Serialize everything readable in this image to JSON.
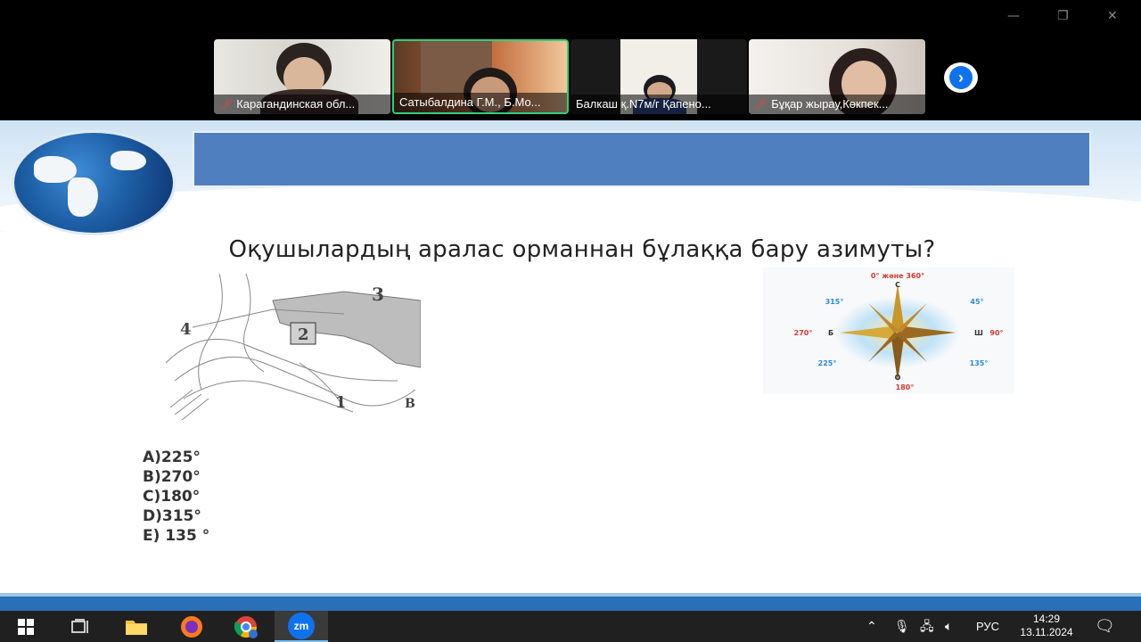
{
  "zoom": {
    "window_controls": {
      "minimize": "—",
      "restore": "❐",
      "close": "✕"
    },
    "participants": [
      {
        "name": "Карагандинская обл...",
        "muted": true
      },
      {
        "name": "Сатыбалдина Г.М., Б.Мо...",
        "muted": false,
        "active_speaker": true
      },
      {
        "name": "Балкаш қ.N7м/г Қапено...",
        "muted": false
      },
      {
        "name": "Бұқар жырау,Көкпек...",
        "muted": true
      }
    ],
    "next_icon": "›"
  },
  "slide": {
    "question": "Оқушылардың аралас орманнан бұлаққа бару азимуты?",
    "map_labels": {
      "one": "1",
      "two": "2",
      "three": "3",
      "four": "4",
      "b": "B"
    },
    "compass": {
      "top": "0° және 360°",
      "north": "С",
      "south": "О",
      "west": "Б",
      "east": "Ш",
      "deg_45": "45°",
      "deg_90": "90°",
      "deg_135": "135°",
      "deg_180": "180°",
      "deg_225": "225°",
      "deg_270": "270°",
      "deg_315": "315°"
    },
    "answers": [
      "A)225°",
      "B)270°",
      "C)180°",
      "D)315°",
      "E) 135 °"
    ]
  },
  "taskbar": {
    "tray": {
      "language": "РУС",
      "time": "14:29",
      "date": "13.11.2024"
    },
    "colors": {
      "accent": "#0e72ed"
    }
  }
}
